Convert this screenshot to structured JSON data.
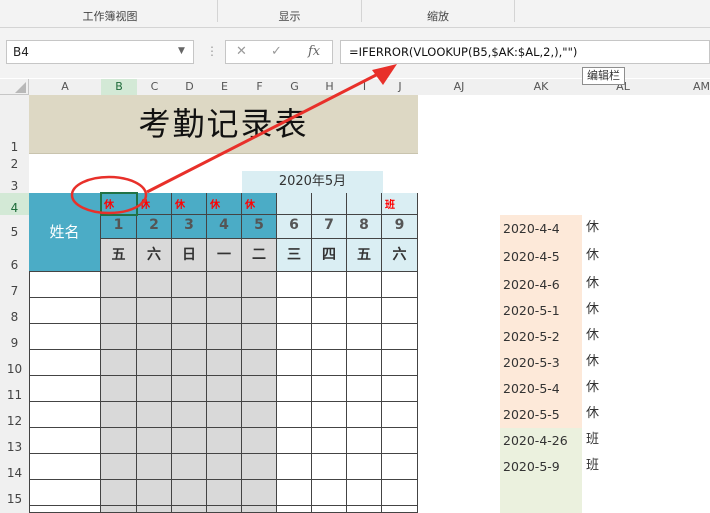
{
  "ribbon": {
    "groups": [
      "工作簿视图",
      "显示",
      "缩放"
    ]
  },
  "formula_bar": {
    "name_box": "B4",
    "cancel_icon": "✕",
    "enter_icon": "✓",
    "fx_label": "fx",
    "formula": "=IFERROR(VLOOKUP(B5,$AK:$AL,2,),\"\")",
    "tooltip": "编辑栏"
  },
  "columns": [
    "A",
    "B",
    "C",
    "D",
    "E",
    "F",
    "G",
    "H",
    "I",
    "J",
    "AJ",
    "AK",
    "AL",
    "AM"
  ],
  "selected_column": "B",
  "rows": [
    "1",
    "2",
    "3",
    "4",
    "5",
    "6",
    "7",
    "8",
    "9",
    "10",
    "11",
    "12",
    "13",
    "14",
    "15"
  ],
  "selected_row": "4",
  "sheet": {
    "title": "考勤记录表",
    "month": "2020年5月",
    "name_header": "姓名",
    "marks": [
      "休",
      "休",
      "休",
      "休",
      "休",
      "",
      "",
      "",
      "班"
    ],
    "days": [
      "1",
      "2",
      "3",
      "4",
      "5",
      "6",
      "7",
      "8",
      "9"
    ],
    "weekdays": [
      "五",
      "六",
      "日",
      "一",
      "二",
      "三",
      "四",
      "五",
      "六"
    ]
  },
  "reference_table": [
    {
      "date": "2020-4-4",
      "type": "休"
    },
    {
      "date": "2020-4-5",
      "type": "休"
    },
    {
      "date": "2020-4-6",
      "type": "休"
    },
    {
      "date": "2020-5-1",
      "type": "休"
    },
    {
      "date": "2020-5-2",
      "type": "休"
    },
    {
      "date": "2020-5-3",
      "type": "休"
    },
    {
      "date": "2020-5-4",
      "type": "休"
    },
    {
      "date": "2020-5-5",
      "type": "休"
    },
    {
      "date": "2020-4-26",
      "type": "班"
    },
    {
      "date": "2020-5-9",
      "type": "班"
    }
  ],
  "colors": {
    "title_bg": "#ddd8c4",
    "header_blue": "#4bacc6",
    "header_light": "#daeef3",
    "weekend_grey": "#d9d9d9",
    "holiday_bg": "#fde9d9",
    "workday_bg": "#ebf1de",
    "annotation_red": "#e8302a",
    "mark_red": "#ff0000"
  }
}
